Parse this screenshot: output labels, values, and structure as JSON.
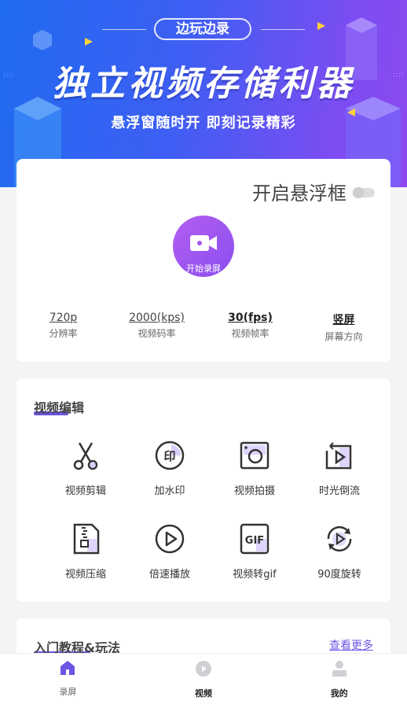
{
  "banner": {
    "tag": "边玩边录",
    "headline": "独立视频存储利器",
    "subline": "悬浮窗随时开  即刻记录精彩"
  },
  "recorder": {
    "float_label": "开启悬浮框",
    "float_enabled": false,
    "record_label": "开始录屏",
    "params": [
      {
        "value": "720p",
        "key": "分辨率"
      },
      {
        "value": "2000(kps)",
        "key": "视频码率"
      },
      {
        "value": "30(fps)",
        "key": "视频帧率"
      },
      {
        "value": "竖屏",
        "key": "屏幕方向"
      }
    ]
  },
  "editor": {
    "title": "视频编辑",
    "tools": [
      {
        "name": "视频剪辑",
        "icon": "scissors-icon"
      },
      {
        "name": "加水印",
        "icon": "stamp-icon"
      },
      {
        "name": "视频拍摄",
        "icon": "camera-icon"
      },
      {
        "name": "时光倒流",
        "icon": "rewind-icon"
      },
      {
        "name": "视频压缩",
        "icon": "compress-icon"
      },
      {
        "name": "倍速播放",
        "icon": "play-speed-icon"
      },
      {
        "name": "视频转gif",
        "icon": "gif-icon"
      },
      {
        "name": "90度旋转",
        "icon": "rotate-icon"
      }
    ]
  },
  "tutorial": {
    "title": "入门教程&玩法",
    "more": "查看更多"
  },
  "nav": [
    {
      "label": "录屏",
      "icon": "home-icon"
    },
    {
      "label": "视频",
      "icon": "video-icon"
    },
    {
      "label": "我的",
      "icon": "user-icon"
    }
  ],
  "colors": {
    "accent": "#6f55e6",
    "banner_start": "#1f6bf0",
    "banner_end": "#8d49f0"
  }
}
